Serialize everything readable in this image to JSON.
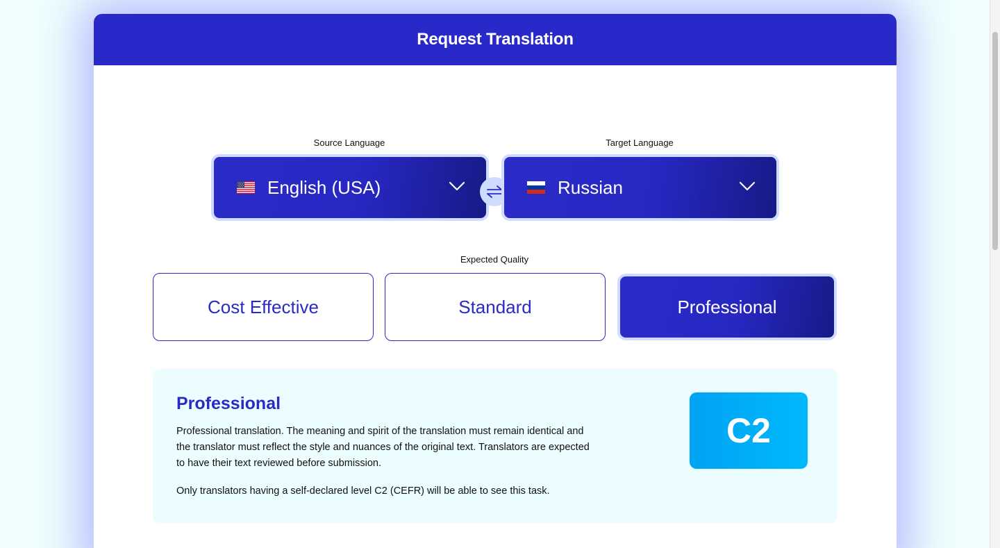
{
  "header": {
    "title": "Request Translation"
  },
  "languages": {
    "source_label": "Source Language",
    "target_label": "Target Language",
    "source": {
      "name": "English (USA)",
      "flag": "us-flag-icon"
    },
    "target": {
      "name": "Russian",
      "flag": "russia-flag-icon"
    },
    "swap_icon": "swap-arrows-icon"
  },
  "quality": {
    "label": "Expected Quality",
    "options": [
      {
        "label": "Cost Effective",
        "selected": false
      },
      {
        "label": "Standard",
        "selected": false
      },
      {
        "label": "Professional",
        "selected": true
      }
    ]
  },
  "details": {
    "title": "Professional",
    "description": "Professional translation. The meaning and spirit of the translation must remain identical and the translator must reflect the style and nuances of the original text. Translators are expected to have their text reviewed before submission.",
    "note": "Only translators having a self-declared level C2 (CEFR) will be able to see this task.",
    "level": "C2"
  },
  "colors": {
    "primary": "#2929c9",
    "primary_dark": "#171a86",
    "accent_light": "#cfdcff",
    "badge": "#00b0f8",
    "panel_bg": "#ebfdfe"
  }
}
